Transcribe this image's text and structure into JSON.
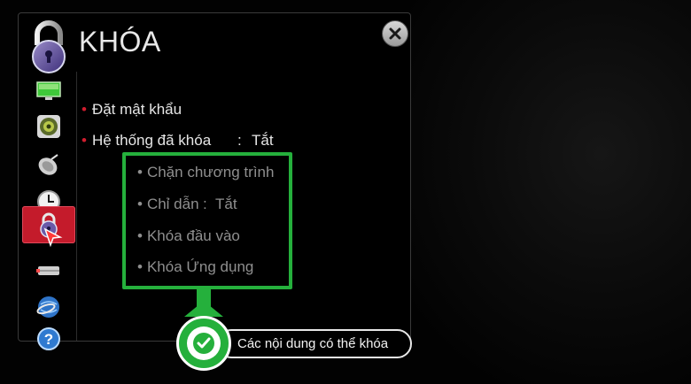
{
  "header": {
    "title": "KHÓA"
  },
  "icons": {
    "title": "padlock-icon",
    "close": "close-icon",
    "sidebar": [
      "tv-screen-icon",
      "speaker-icon",
      "satellite-dish-icon",
      "clock-icon",
      "padlock-icon",
      "cable-icon",
      "globe-network-icon",
      "help-icon"
    ]
  },
  "sidebar": {
    "selected_index": 4
  },
  "menu": {
    "set_password": "Đặt mật khẩu",
    "system_lock": "Hệ thống đã khóa",
    "system_lock_sep": ":",
    "system_lock_value": "Tắt",
    "sub_items": {
      "block_program": "Chặn chương trình",
      "guide_label": "Chỉ dẫn",
      "guide_sep": ":",
      "guide_value": "Tắt",
      "input_lock": "Khóa đầu vào",
      "app_lock": "Khóa Ứng dụng"
    }
  },
  "callout": {
    "text": "Các nội dung có thể khóa"
  },
  "colors": {
    "accent_red": "#c41b2b",
    "highlight_green": "#25b03c",
    "text_primary": "#e6e6e6",
    "text_dim": "#8f8f8f"
  }
}
